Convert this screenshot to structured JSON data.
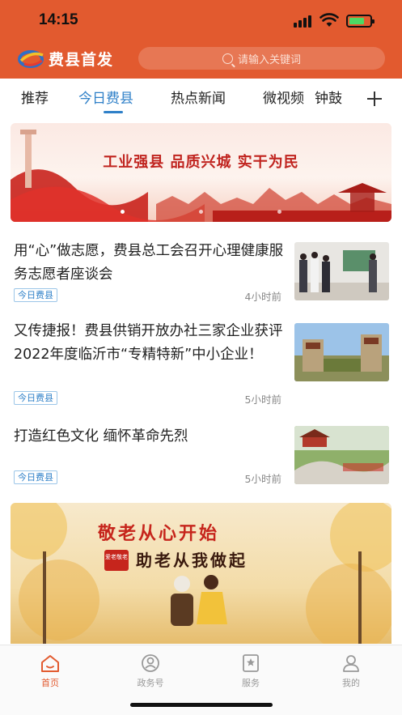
{
  "status_bar": {
    "time": "14:15"
  },
  "header": {
    "app_name": "费县首发",
    "search_placeholder": "请输入关键词",
    "logo_icon": "feixian-logo-icon",
    "search_icon": "search-icon"
  },
  "tabs": {
    "items": [
      {
        "label": "推荐"
      },
      {
        "label": "今日费县",
        "active": true
      },
      {
        "label": "热点新闻"
      },
      {
        "label": "微视频"
      },
      {
        "label": "钟鼓"
      }
    ],
    "add_icon": "plus-icon"
  },
  "banner": {
    "title": "工业强县 品质兴城 实干为民",
    "slides": 3,
    "active_slide": 1
  },
  "news": [
    {
      "title": "用“心”做志愿，费县总工会召开心理健康服务志愿者座谈会",
      "tag": "今日费县",
      "time": "4小时前"
    },
    {
      "title": "又传捷报！费县供销开放办社三家企业获评2022年度临沂市“专精特新”中小企业！",
      "tag": "今日费县",
      "time": "5小时前"
    },
    {
      "title": "打造红色文化  缅怀革命先烈",
      "tag": "今日费县",
      "time": "5小时前"
    }
  ],
  "ad": {
    "line1": "敬老从心开始",
    "line2": "助老从我做起",
    "stamp": "爱老敬老"
  },
  "tabbar": {
    "items": [
      {
        "label": "首页",
        "icon": "home-icon",
        "active": true
      },
      {
        "label": "政务号",
        "icon": "government-account-icon"
      },
      {
        "label": "服务",
        "icon": "service-icon"
      },
      {
        "label": "我的",
        "icon": "profile-icon"
      }
    ]
  },
  "colors": {
    "brand": "#e25a2f",
    "accent_blue": "#2f80c8",
    "banner_red": "#c0241f"
  }
}
